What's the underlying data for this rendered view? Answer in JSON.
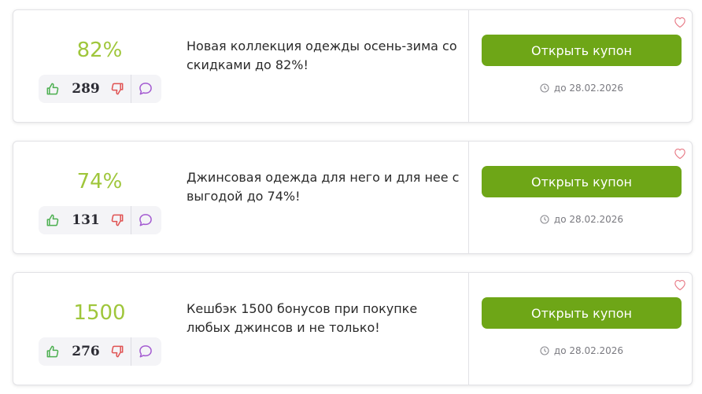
{
  "colors": {
    "discount": "#9fc63b",
    "button": "#6ea617",
    "like": "#4caf50",
    "dislike": "#e05252",
    "comment": "#a45bd1",
    "heart": "#e87b87"
  },
  "coupons": [
    {
      "discount": "82%",
      "votes": "289",
      "title": "Новая коллекция одежды осень-зима со скидками до 82%!",
      "button_label": "Открыть купон",
      "expiry": "до 28.02.2026"
    },
    {
      "discount": "74%",
      "votes": "131",
      "title": "Джинсовая одежда для него и для нее с выгодой до 74%!",
      "button_label": "Открыть купон",
      "expiry": "до 28.02.2026"
    },
    {
      "discount": "1500",
      "votes": "276",
      "title": "Кешбэк 1500 бонусов при покупке любых джинсов и не только!",
      "button_label": "Открыть купон",
      "expiry": "до 28.02.2026"
    }
  ]
}
